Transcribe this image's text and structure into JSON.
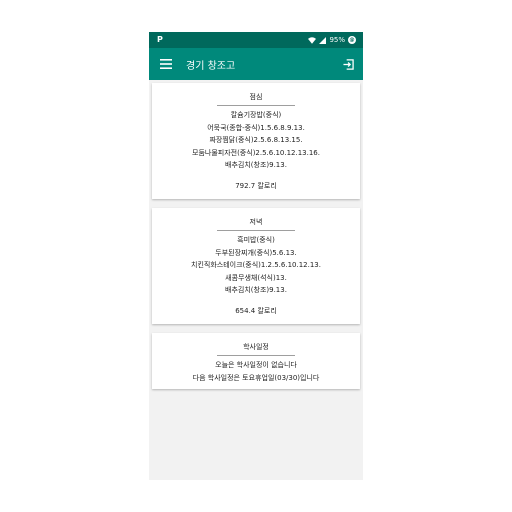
{
  "status_bar": {
    "left_icon": "P",
    "battery_text": "95%",
    "battery_badge": "@",
    "icons": [
      "wifi-icon",
      "signal-icon"
    ]
  },
  "app_bar": {
    "title": "경기 창조고",
    "menu_icon": "hamburger-menu-icon",
    "exit_icon": "exit-to-app-icon"
  },
  "lunch": {
    "title": "점심",
    "items": [
      "칼슘기장밥(중식)",
      "어묵국(종합-중식)1.5.6.8.9.13.",
      "짜장찜닭(중식)2.5.6.8.13.15.",
      "모둠나물피자전(중식)2.5.6.10.12.13.16.",
      "배추김치(창조)9.13."
    ],
    "calories": "792.7 칼로리"
  },
  "dinner": {
    "title": "저녁",
    "items": [
      "흑미밥(중식)",
      "두부된장찌개(중식)5.6.13.",
      "치킨직화스테이크(중식)1.2.5.6.10.12.13.",
      "새콤무생채(석식)13.",
      "배추김치(창조)9.13."
    ],
    "calories": "654.4 칼로리"
  },
  "schedule": {
    "title": "학사일정",
    "lines": [
      "오늘은 학사일정이 없습니다",
      "다음 학사일정은 토요휴업일(03/30)입니다"
    ]
  },
  "colors": {
    "status_bar": "#00695c",
    "app_bar": "#00897b",
    "background": "#f2f2f2",
    "card": "#ffffff"
  }
}
